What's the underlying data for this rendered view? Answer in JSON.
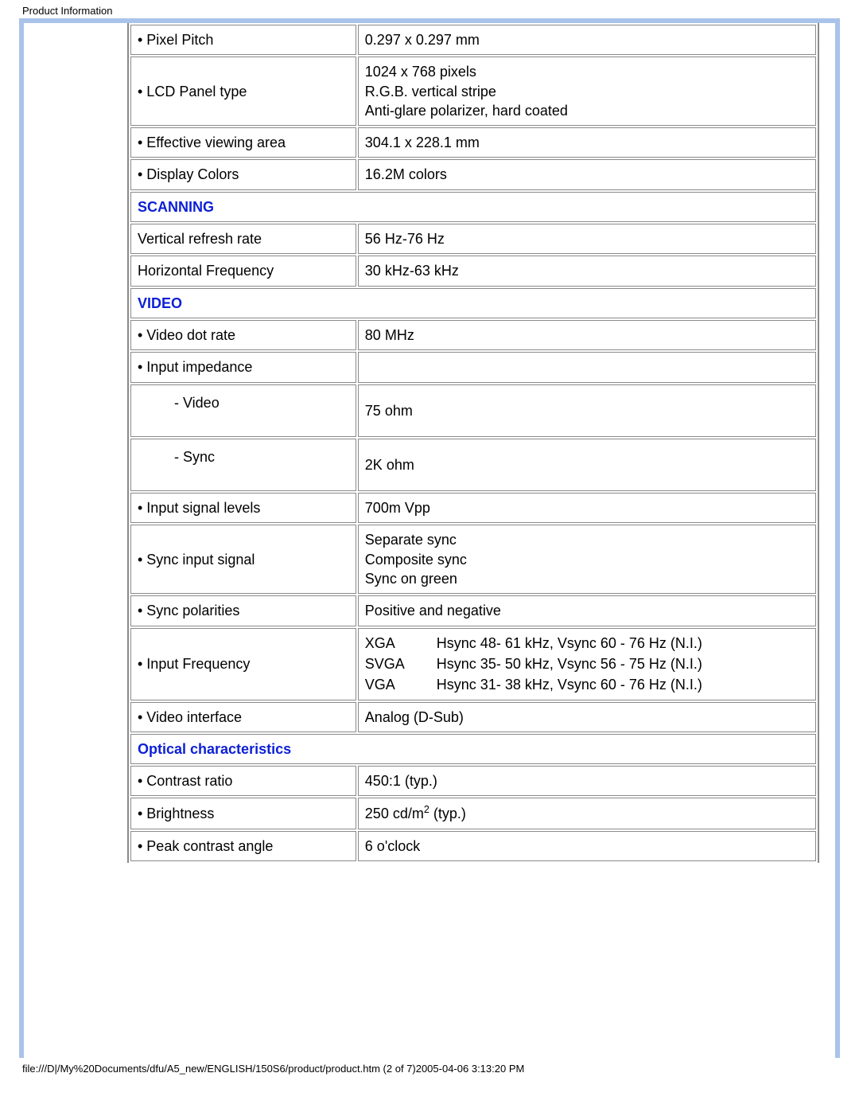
{
  "meta": {
    "page_title": "Product Information",
    "footer_path": "file:///D|/My%20Documents/dfu/A5_new/ENGLISH/150S6/product/product.htm (2 of 7)2005-04-06 3:13:20 PM"
  },
  "rows": {
    "pixel_pitch_label": "• Pixel Pitch",
    "pixel_pitch_value": "0.297 x 0.297 mm",
    "lcd_panel_label": "• LCD Panel type",
    "lcd_panel_l1": "1024 x 768 pixels",
    "lcd_panel_l2": "R.G.B. vertical stripe",
    "lcd_panel_l3": "Anti-glare polarizer, hard coated",
    "eff_view_label": "• Effective viewing area",
    "eff_view_value": "304.1 x 228.1 mm",
    "disp_colors_label": "• Display Colors",
    "disp_colors_value": "16.2M colors",
    "scanning_head": "SCANNING",
    "vrefresh_label": "Vertical refresh rate",
    "vrefresh_value": "56 Hz-76 Hz",
    "hfreq_label": "Horizontal Frequency",
    "hfreq_value": "30 kHz-63 kHz",
    "video_head": "VIDEO",
    "vdot_label": "• Video dot rate",
    "vdot_value": "80 MHz",
    "imped_label": "• Input impedance",
    "imped_video_label": "- Video",
    "imped_video_value": "75 ohm",
    "imped_sync_label": "- Sync",
    "imped_sync_value": "2K ohm",
    "sig_levels_label": "• Input signal levels",
    "sig_levels_value": "700m Vpp",
    "sync_input_label": "• Sync input signal",
    "sync_input_l1": "Separate sync",
    "sync_input_l2": "Composite sync",
    "sync_input_l3": "Sync on green",
    "sync_pol_label": "• Sync polarities",
    "sync_pol_value": "Positive and negative",
    "input_freq_label": "• Input Frequency",
    "freq_xga_mode": "XGA",
    "freq_xga_val": "Hsync 48- 61 kHz, Vsync 60 - 76 Hz (N.I.)",
    "freq_svga_mode": "SVGA",
    "freq_svga_val": "Hsync 35- 50 kHz, Vsync 56 - 75 Hz (N.I.)",
    "freq_vga_mode": "VGA",
    "freq_vga_val": "Hsync 31- 38 kHz, Vsync 60 - 76 Hz (N.I.)",
    "video_if_label": "• Video interface",
    "video_if_value": "Analog (D-Sub)",
    "optical_head": "Optical characteristics",
    "contrast_label": "• Contrast ratio",
    "contrast_value": "450:1 (typ.)",
    "brightness_label": "• Brightness",
    "brightness_prefix": "250 cd/m",
    "brightness_sup": "2",
    "brightness_suffix": " (typ.)",
    "peak_angle_label": "• Peak contrast angle",
    "peak_angle_value": "6 o'clock"
  }
}
